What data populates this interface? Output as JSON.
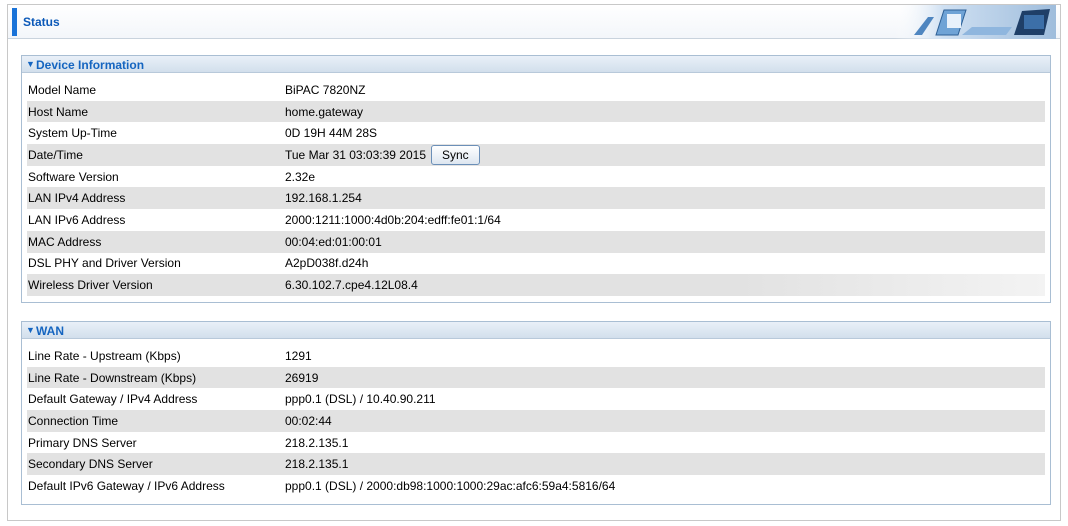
{
  "header": {
    "title": "Status"
  },
  "device_info": {
    "title": "Device Information",
    "rows": [
      {
        "label": "Model Name",
        "value": "BiPAC 7820NZ"
      },
      {
        "label": "Host Name",
        "value": "home.gateway"
      },
      {
        "label": "System Up-Time",
        "value": "0D 19H 44M 28S"
      },
      {
        "label": "Date/Time",
        "value": "Tue Mar 31 03:03:39 2015",
        "button": "Sync"
      },
      {
        "label": "Software Version",
        "value": "2.32e"
      },
      {
        "label": "LAN IPv4 Address",
        "value": "192.168.1.254"
      },
      {
        "label": "LAN IPv6 Address",
        "value": "2000:1211:1000:4d0b:204:edff:fe01:1/64"
      },
      {
        "label": "MAC Address",
        "value": "00:04:ed:01:00:01"
      },
      {
        "label": "DSL PHY and Driver Version",
        "value": "A2pD038f.d24h"
      },
      {
        "label": "Wireless Driver Version",
        "value": "6.30.102.7.cpe4.12L08.4"
      }
    ]
  },
  "wan": {
    "title": "WAN",
    "rows": [
      {
        "label": "Line Rate - Upstream (Kbps)",
        "value": "1291"
      },
      {
        "label": "Line Rate - Downstream (Kbps)",
        "value": "26919"
      },
      {
        "label": "Default Gateway / IPv4 Address",
        "value": "ppp0.1 (DSL) / 10.40.90.211"
      },
      {
        "label": "Connection Time",
        "value": "00:02:44"
      },
      {
        "label": "Primary DNS Server",
        "value": "218.2.135.1"
      },
      {
        "label": "Secondary DNS Server",
        "value": "218.2.135.1"
      },
      {
        "label": "Default IPv6 Gateway / IPv6 Address",
        "value": "ppp0.1 (DSL) / 2000:db98:1000:1000:29ac:afc6:59a4:5816/64"
      }
    ]
  },
  "icons": {
    "section_toggle": "triangle-down-icon",
    "header_graphic": "computer-illustration"
  },
  "colors": {
    "accent": "#1a73d8",
    "section_title": "#1565c0",
    "row_shade": "#e2e2e2"
  }
}
